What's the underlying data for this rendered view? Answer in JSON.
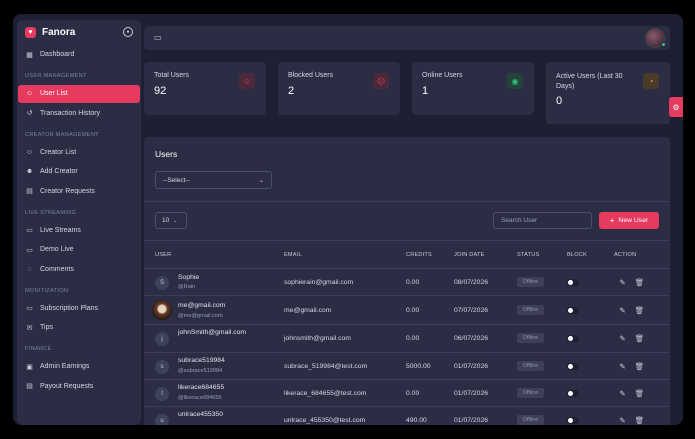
{
  "app": {
    "brand": "Fanora",
    "accent": "#e63a5f"
  },
  "sidebar": {
    "dashboard": "Dashboard",
    "sections": [
      {
        "title": "USER MANAGEMENT",
        "items": [
          {
            "label": "User List",
            "icon": "user-icon",
            "active": true
          },
          {
            "label": "Transaction History",
            "icon": "history-icon"
          }
        ]
      },
      {
        "title": "CREATOR MANAGEMENT",
        "items": [
          {
            "label": "Creator List",
            "icon": "user-icon"
          },
          {
            "label": "Add Creator",
            "icon": "user-plus-icon"
          },
          {
            "label": "Creator Requests",
            "icon": "document-icon"
          }
        ]
      },
      {
        "title": "LIVE STREAMING",
        "items": [
          {
            "label": "Live Streams",
            "icon": "video-icon"
          },
          {
            "label": "Demo Live",
            "icon": "video-icon"
          },
          {
            "label": "Comments",
            "icon": "comment-icon"
          }
        ]
      },
      {
        "title": "MONITIZATION",
        "items": [
          {
            "label": "Subscription Plans",
            "icon": "card-icon"
          },
          {
            "label": "Tips",
            "icon": "tip-icon"
          }
        ]
      },
      {
        "title": "FINANCE",
        "items": [
          {
            "label": "Admin Earnings",
            "icon": "wallet-icon"
          },
          {
            "label": "Payout Requests",
            "icon": "document-icon"
          }
        ]
      }
    ]
  },
  "stats": [
    {
      "title": "Total Users",
      "value": "92",
      "icon": "users-icon",
      "icon_color": "#e63a5f",
      "icon_bg": "#4a2a3a"
    },
    {
      "title": "Blocked Users",
      "value": "2",
      "icon": "user-block-icon",
      "icon_color": "#e63a5f",
      "icon_bg": "#4a2a3a"
    },
    {
      "title": "Online Users",
      "value": "1",
      "icon": "eye-icon",
      "icon_color": "#2ec47b",
      "icon_bg": "#24433a"
    },
    {
      "title": "Active Users (Last 30 Days)",
      "value": "0",
      "icon": "clock-icon",
      "icon_color": "#f0a04b",
      "icon_bg": "#4a3a2a"
    }
  ],
  "panel": {
    "title": "Users",
    "filter_value": "--Select--",
    "per_page": "10",
    "search_placeholder": "Search User",
    "new_button": "New User"
  },
  "table": {
    "headers": [
      "USER",
      "EMAIL",
      "CREDITS",
      "JOIN DATE",
      "STATUS",
      "BLOCK",
      "ACTION"
    ],
    "rows": [
      {
        "initial": "S",
        "name": "Sophie",
        "handle": "@Rain",
        "email": "sophierain@gmail.com",
        "credits": "0.00",
        "join": "08/07/2026",
        "status": "Offline"
      },
      {
        "initial": "",
        "photo": true,
        "name": "me@gmail.com",
        "handle": "@me@gmail.com",
        "email": "me@gmail.com",
        "credits": "0.00",
        "join": "07/07/2026",
        "status": "Offline"
      },
      {
        "initial": "j",
        "name": "johnSmith@gmail.com",
        "handle": "",
        "email": "johnsmith@gmail.com",
        "credits": "0.00",
        "join": "06/07/2026",
        "status": "Offline"
      },
      {
        "initial": "s",
        "name": "subrace519984",
        "handle": "@subrace519984",
        "email": "subrace_519984@test.com",
        "credits": "5000.00",
        "join": "01/07/2026",
        "status": "Offline"
      },
      {
        "initial": "l",
        "name": "likerace684655",
        "handle": "@likerace684655",
        "email": "likerace_684655@test.com",
        "credits": "0.00",
        "join": "01/07/2026",
        "status": "Offline"
      },
      {
        "initial": "u",
        "name": "unlrace455350",
        "handle": "",
        "email": "unlrace_455350@test.com",
        "credits": "490.00",
        "join": "01/07/2026",
        "status": "Offline"
      }
    ]
  }
}
